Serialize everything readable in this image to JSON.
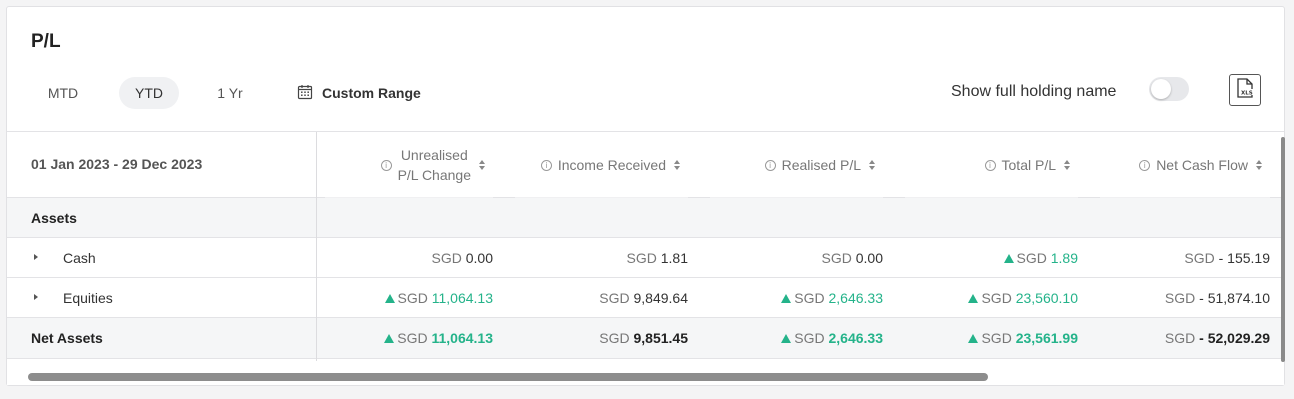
{
  "title": "P/L",
  "periods": {
    "mtd": "MTD",
    "ytd": "YTD",
    "one_year": "1 Yr"
  },
  "custom_range_label": "Custom Range",
  "toggle_label": "Show full holding name",
  "toggle_on": false,
  "date_range": "01 Jan 2023 - 29 Dec 2023",
  "columns": {
    "unrealised_line1": "Unrealised",
    "unrealised_line2": "P/L Change",
    "income": "Income Received",
    "realised": "Realised P/L",
    "total": "Total P/L",
    "net_cash_flow": "Net Cash Flow"
  },
  "rows": {
    "assets": {
      "label": "Assets"
    },
    "cash": {
      "label": "Cash",
      "unrealised": {
        "ccy": "SGD",
        "value": "0.00"
      },
      "income": {
        "ccy": "SGD",
        "value": "1.81"
      },
      "realised": {
        "ccy": "SGD",
        "value": "0.00"
      },
      "total": {
        "ccy": "SGD",
        "value": "1.89"
      },
      "net_cash_flow": {
        "ccy": "SGD",
        "value": "- 155.19"
      }
    },
    "equities": {
      "label": "Equities",
      "unrealised": {
        "ccy": "SGD",
        "value": "11,064.13"
      },
      "income": {
        "ccy": "SGD",
        "value": "9,849.64"
      },
      "realised": {
        "ccy": "SGD",
        "value": "2,646.33"
      },
      "total": {
        "ccy": "SGD",
        "value": "23,560.10"
      },
      "net_cash_flow": {
        "ccy": "SGD",
        "value": "- 51,874.10"
      }
    },
    "net_assets": {
      "label": "Net Assets",
      "unrealised": {
        "ccy": "SGD",
        "value": "11,064.13"
      },
      "income": {
        "ccy": "SGD",
        "value": "9,851.45"
      },
      "realised": {
        "ccy": "SGD",
        "value": "2,646.33"
      },
      "total": {
        "ccy": "SGD",
        "value": "23,561.99"
      },
      "net_cash_flow": {
        "ccy": "SGD",
        "value": "- 52,029.29"
      }
    }
  },
  "colors": {
    "positive": "#24b38a",
    "active_tab_bg": "#f0f1f3"
  }
}
